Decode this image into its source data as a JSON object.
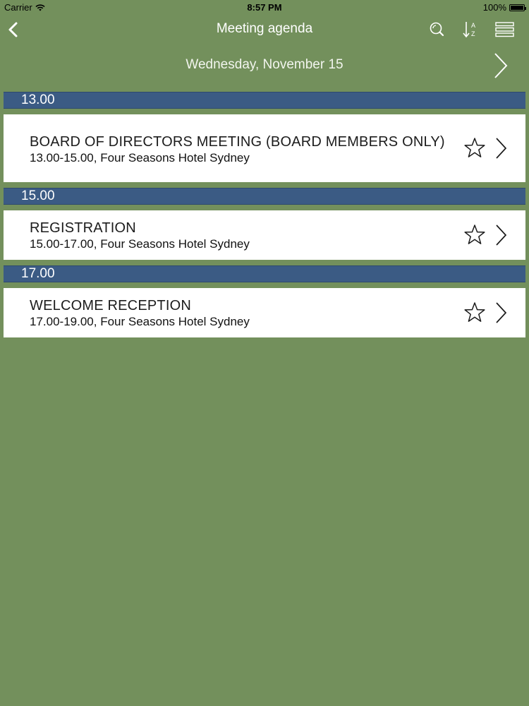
{
  "status_bar": {
    "carrier": "Carrier",
    "time": "8:57 PM",
    "battery": "100%",
    "battery_level": 1.0
  },
  "nav": {
    "title": "Meeting agenda",
    "back_icon": "chevron-left-icon",
    "search_icon": "search-icon",
    "sort_icon": "sort-az-icon",
    "menu_icon": "menu-icon",
    "sort_letters": [
      "A",
      "Z"
    ]
  },
  "date_bar": {
    "label": "Wednesday, November 15",
    "next_icon": "chevron-right-icon"
  },
  "colors": {
    "background": "#73905c",
    "section_header": "#3b5b84",
    "item_background": "#ffffff"
  },
  "sections": [
    {
      "time": "13.00",
      "items": [
        {
          "title": "BOARD OF DIRECTORS MEETING (BOARD MEMBERS ONLY)",
          "subtitle": "13.00-15.00, Four Seasons Hotel Sydney",
          "favorite": false
        }
      ]
    },
    {
      "time": "15.00",
      "items": [
        {
          "title": "REGISTRATION",
          "subtitle": "15.00-17.00, Four Seasons Hotel Sydney",
          "favorite": false
        }
      ]
    },
    {
      "time": "17.00",
      "items": [
        {
          "title": "WELCOME RECEPTION",
          "subtitle": "17.00-19.00, Four Seasons Hotel Sydney",
          "favorite": false
        }
      ]
    }
  ]
}
